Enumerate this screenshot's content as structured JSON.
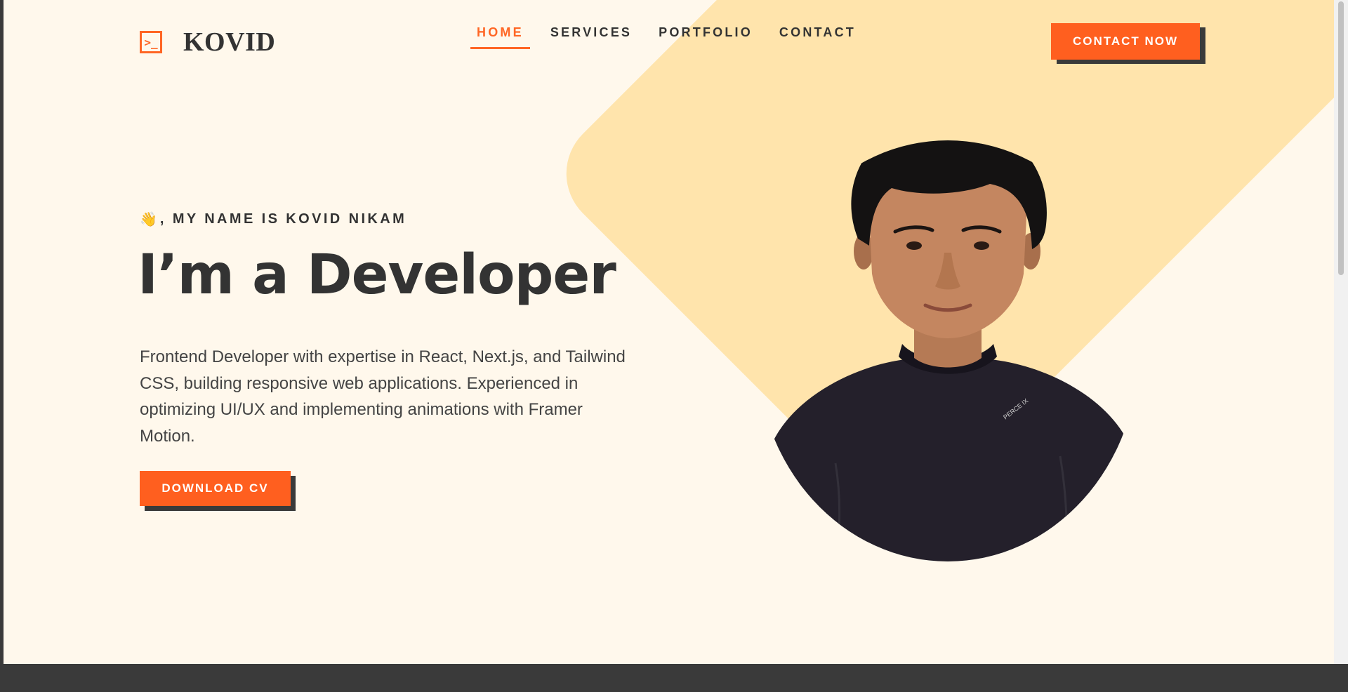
{
  "header": {
    "logo_symbol": ">_",
    "logo_text": "KOVID",
    "nav": [
      {
        "label": "HOME",
        "active": true
      },
      {
        "label": "SERVICES",
        "active": false
      },
      {
        "label": "PORTFOLIO",
        "active": false
      },
      {
        "label": "CONTACT",
        "active": false
      }
    ],
    "cta_label": "CONTACT NOW"
  },
  "hero": {
    "wave_emoji": "👋",
    "intro": ", MY NAME IS KOVID NIKAM",
    "headline": "I’m a Developer",
    "bio": "Frontend Developer with expertise in React, Next.js, and Tailwind CSS, building responsive web applications. Experienced in optimizing UI/UX and implementing animations with Framer Motion.",
    "download_label": "DOWNLOAD CV",
    "portrait_icon": "portrait-photo-icon"
  },
  "colors": {
    "accent": "#ff5f1f",
    "background": "#fff8ec",
    "diamond": "#ffe4ac",
    "dark": "#333333"
  }
}
